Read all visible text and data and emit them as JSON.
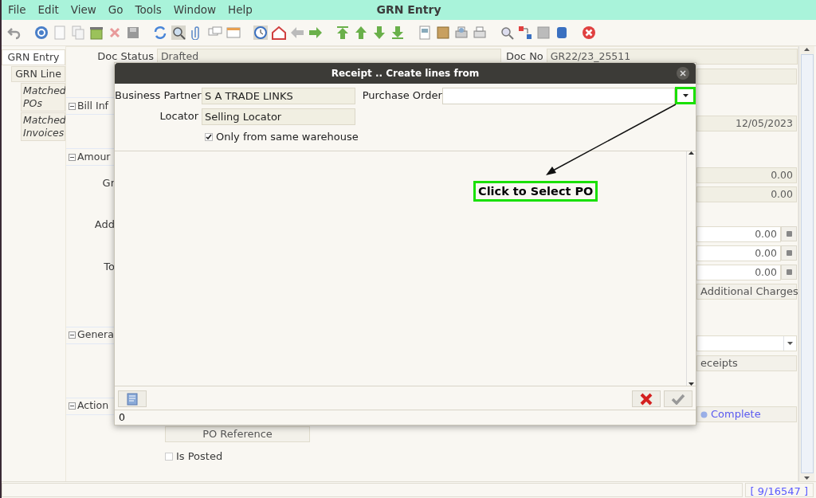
{
  "menu": [
    "File",
    "Edit",
    "View",
    "Go",
    "Tools",
    "Window",
    "Help"
  ],
  "window": {
    "title": "GRN Entry"
  },
  "tabs": [
    {
      "label": "GRN Entry",
      "selected": true,
      "children": [
        {
          "label": "GRN Line",
          "selected": false,
          "children": [
            {
              "label": "Matched POs",
              "selected": false
            },
            {
              "label": "Matched Invoices",
              "selected": false
            }
          ]
        }
      ]
    }
  ],
  "form": {
    "doc_status_label": "Doc Status",
    "doc_status": "Drafted",
    "doc_no_label": "Doc No",
    "doc_no": "GR22/23_25511",
    "left_items": [
      {
        "kind": "section",
        "text": "Bill Inf"
      },
      {
        "kind": "section",
        "text": "Amour"
      },
      {
        "kind": "label",
        "text": "Gr"
      },
      {
        "kind": "label",
        "text": "Add"
      },
      {
        "kind": "label",
        "text": "To"
      },
      {
        "kind": "section",
        "text": "Genera"
      },
      {
        "kind": "section",
        "text": "Action"
      }
    ],
    "right_items": [
      {
        "kind": "field"
      },
      {
        "kind": "field",
        "value": "12/05/2023"
      },
      {
        "kind": "field",
        "value": "0.00"
      },
      {
        "kind": "field",
        "value": "0.00"
      },
      {
        "kind": "number",
        "value": "0.00"
      },
      {
        "kind": "number",
        "value": "0.00"
      },
      {
        "kind": "number",
        "value": "0.00"
      },
      {
        "kind": "button",
        "label": "Additional Charges"
      },
      {
        "kind": "combo"
      },
      {
        "kind": "button",
        "label": "eceipts"
      },
      {
        "kind": "process",
        "label": "Complete"
      }
    ],
    "bottom_items": [
      {
        "kind": "button",
        "label": "PO Reference"
      },
      {
        "kind": "checkbox",
        "label": "Is Posted",
        "checked": false
      }
    ]
  },
  "dialog": {
    "title": "Receipt .. Create lines from",
    "business_partner_label": "Business Partner",
    "business_partner": "S A TRADE LINKS",
    "purchase_order_label": "Purchase Order",
    "locator_label": "Locator",
    "locator": "Selling Locator",
    "same_warehouse": {
      "label": "Only from same warehouse",
      "checked": true
    },
    "status": "0"
  },
  "annotation": {
    "text": "Click to Select PO"
  },
  "status_bar": {
    "record": "[ 9/16547 ]"
  }
}
